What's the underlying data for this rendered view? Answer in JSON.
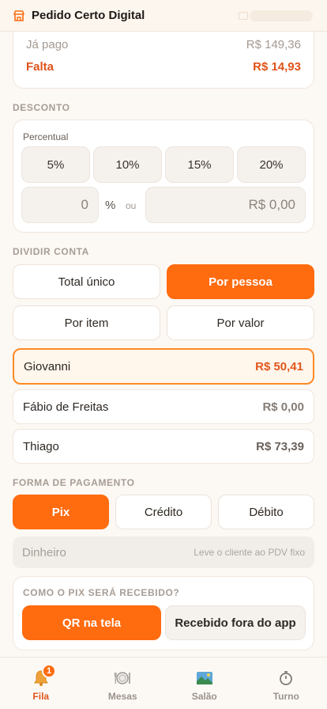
{
  "header": {
    "title": "Pedido Certo Digital",
    "logo_icon": "store-icon"
  },
  "summary": {
    "paid_label": "Já pago",
    "paid_value": "R$ 149,36",
    "remaining_label": "Falta",
    "remaining_value": "R$ 14,93"
  },
  "discount": {
    "section_label": "DESCONTO",
    "caption": "Percentual",
    "presets": [
      "5%",
      "10%",
      "15%",
      "20%"
    ],
    "percent_value": "0",
    "percent_sign": "%",
    "or_label": "ou",
    "amount_value": "R$ 0,00"
  },
  "split": {
    "section_label": "DIVIDIR CONTA",
    "options": [
      "Total único",
      "Por pessoa",
      "Por item",
      "Por valor"
    ],
    "active_option": "Por pessoa"
  },
  "people": [
    {
      "name": "Giovanni",
      "amount": "R$ 50,41",
      "selected": true
    },
    {
      "name": "Fábio de Freitas",
      "amount": "R$ 0,00",
      "selected": false
    },
    {
      "name": "Thiago",
      "amount": "R$ 73,39",
      "selected": false
    }
  ],
  "payment": {
    "section_label": "FORMA DE PAGAMENTO",
    "methods": [
      "Pix",
      "Crédito",
      "Débito"
    ],
    "active_method": "Pix",
    "cash_label": "Dinheiro",
    "cash_hint": "Leve o cliente ao PDV fixo"
  },
  "pix": {
    "title": "COMO O PIX SERÁ RECEBIDO?",
    "options": [
      "QR na tela",
      "Recebido fora do app"
    ],
    "active_option": "QR na tela"
  },
  "nav": {
    "items": [
      {
        "label": "Fila",
        "icon": "bell-icon",
        "badge": "1"
      },
      {
        "label": "Mesas",
        "icon": "plate-icon"
      },
      {
        "label": "Salão",
        "icon": "salon-icon"
      },
      {
        "label": "Turno",
        "icon": "timer-icon"
      }
    ]
  },
  "colors": {
    "accent": "#ff6b0f",
    "danger": "#e0521a",
    "background": "#fcf8f4"
  }
}
